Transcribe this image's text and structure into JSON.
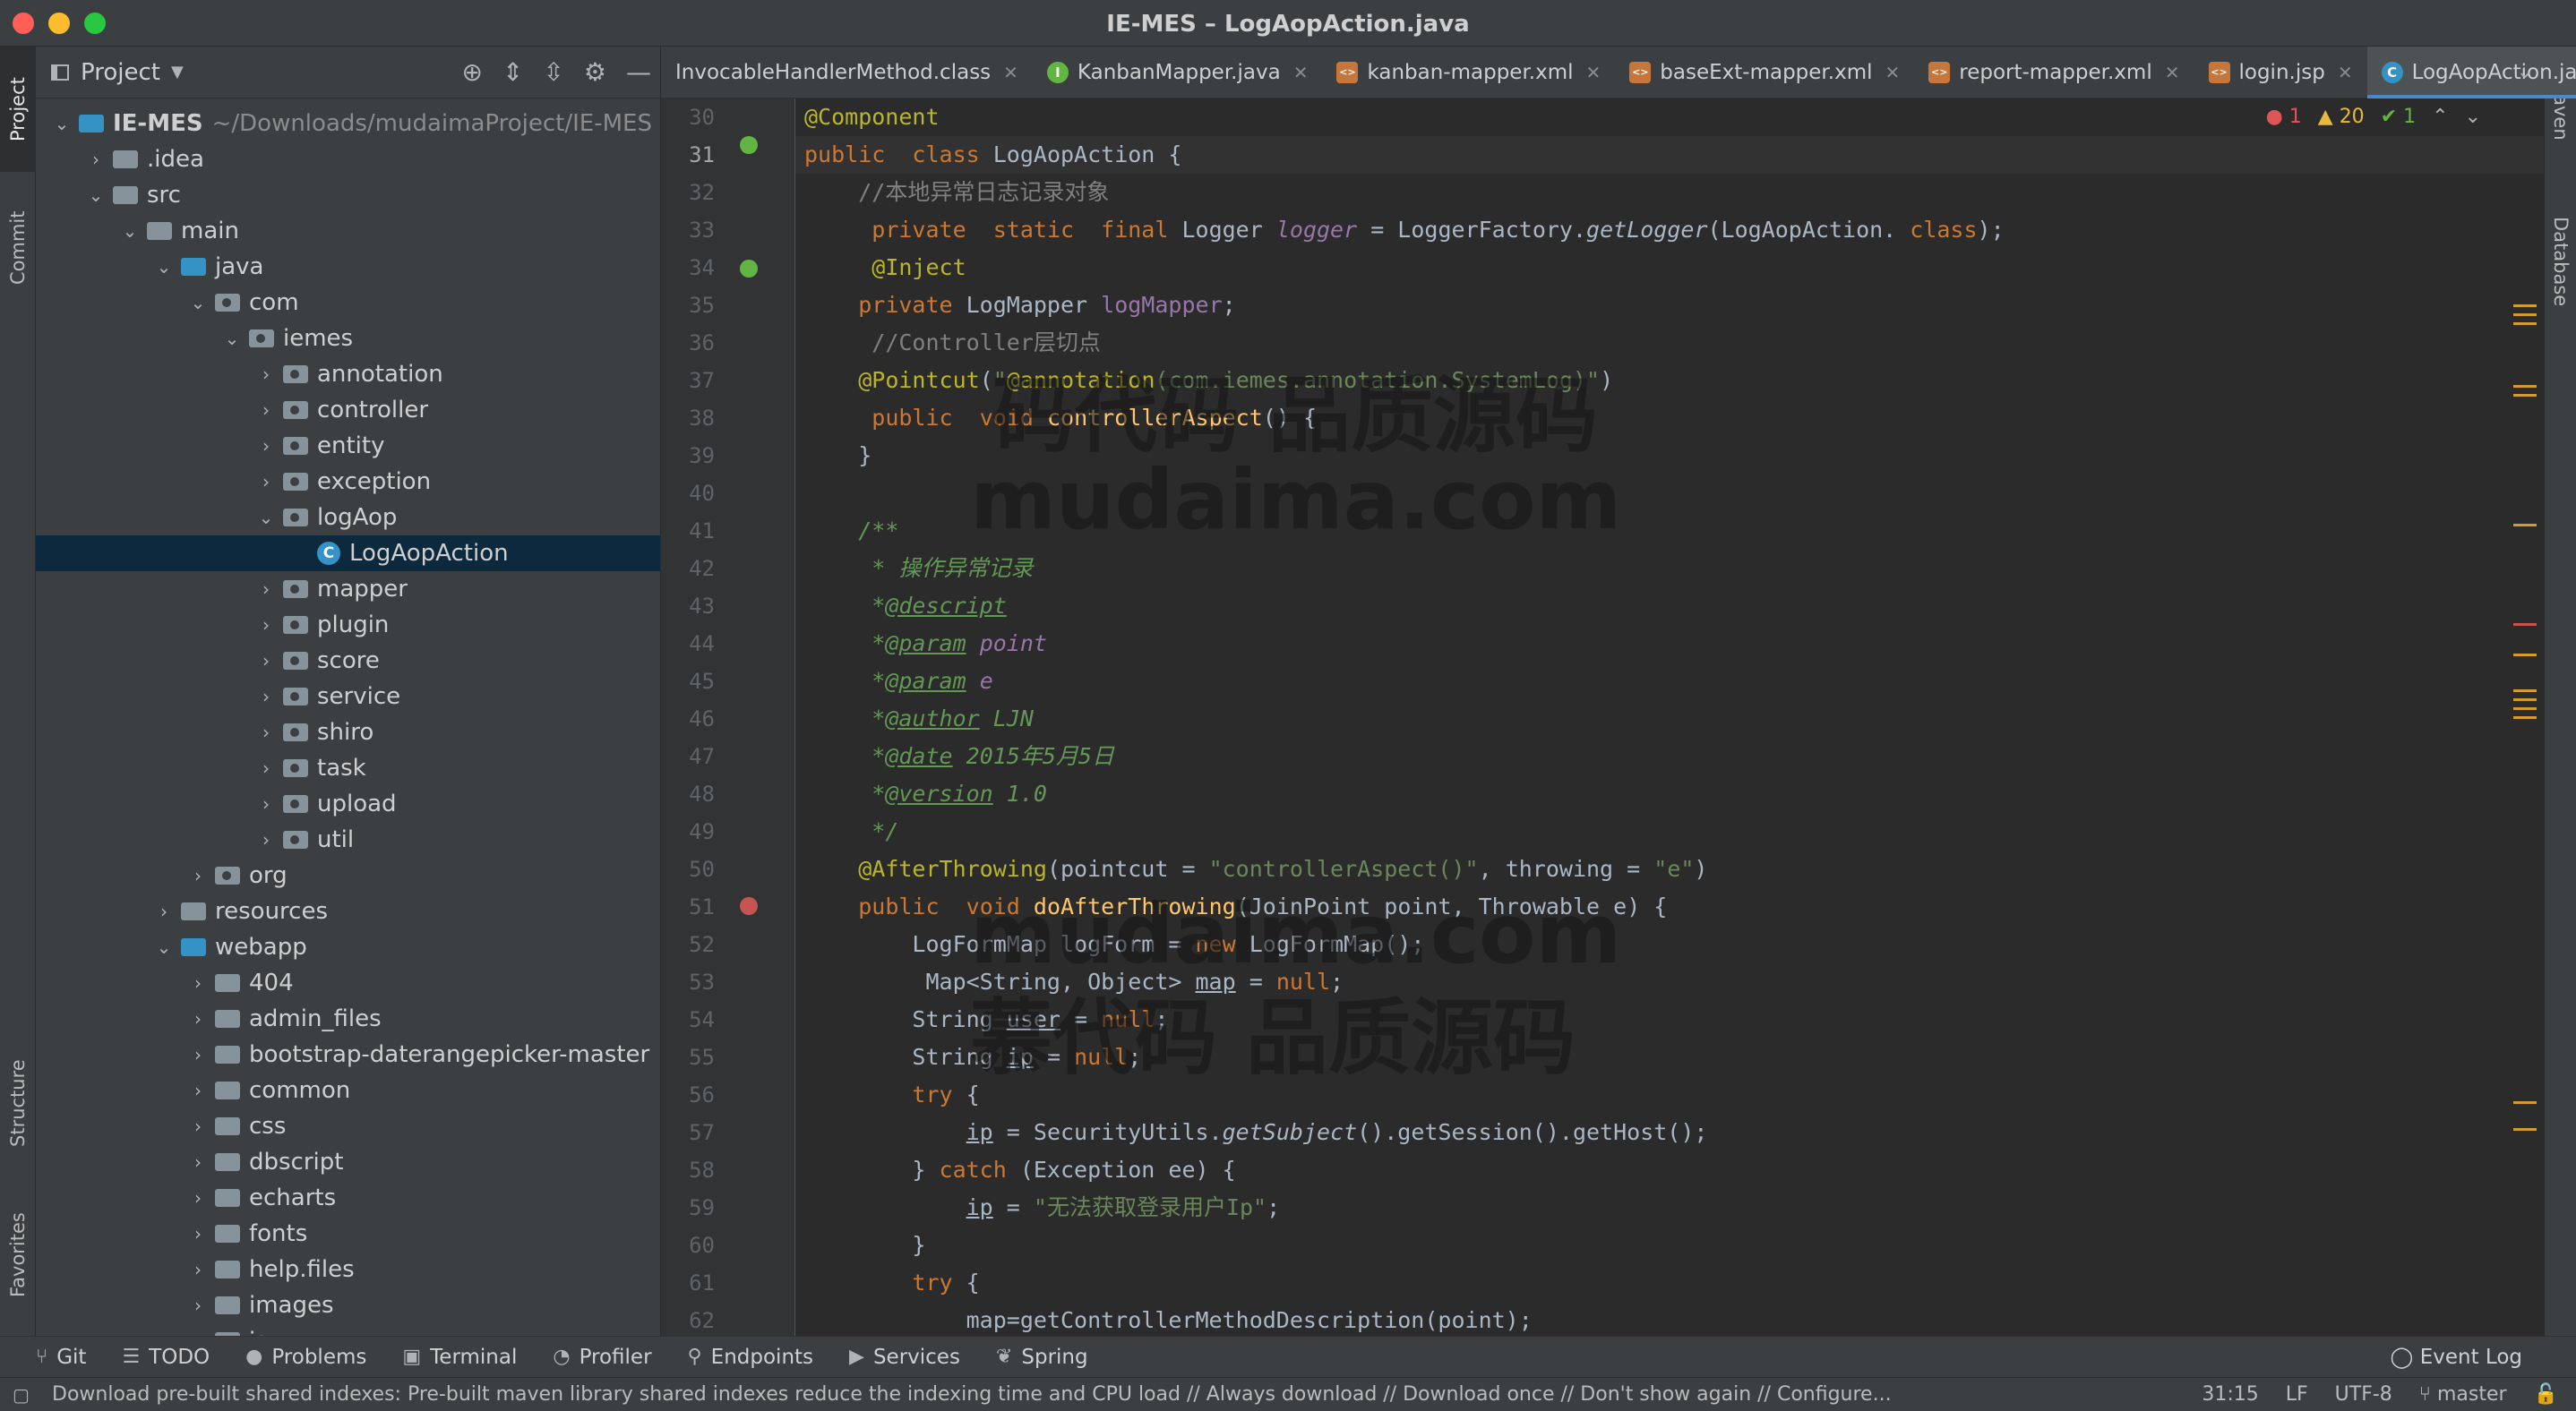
{
  "window": {
    "title": "IE-MES – LogAopAction.java"
  },
  "left_tool_tabs": [
    "Project",
    "Commit",
    "Structure",
    "Favorites"
  ],
  "right_tool_tabs": [
    "Maven",
    "Database"
  ],
  "project_panel": {
    "title": "Project",
    "tree": [
      {
        "label": "IE-MES",
        "sub": "~/Downloads/mudaimaProject/IE-MES",
        "depth": 0,
        "open": true,
        "kind": "module"
      },
      {
        "label": ".idea",
        "depth": 1,
        "open": false,
        "kind": "folder"
      },
      {
        "label": "src",
        "depth": 1,
        "open": true,
        "kind": "folder"
      },
      {
        "label": "main",
        "depth": 2,
        "open": true,
        "kind": "folder"
      },
      {
        "label": "java",
        "depth": 3,
        "open": true,
        "kind": "src"
      },
      {
        "label": "com",
        "depth": 4,
        "open": true,
        "kind": "pkg"
      },
      {
        "label": "iemes",
        "depth": 5,
        "open": true,
        "kind": "pkg"
      },
      {
        "label": "annotation",
        "depth": 6,
        "open": false,
        "kind": "pkg"
      },
      {
        "label": "controller",
        "depth": 6,
        "open": false,
        "kind": "pkg"
      },
      {
        "label": "entity",
        "depth": 6,
        "open": false,
        "kind": "pkg"
      },
      {
        "label": "exception",
        "depth": 6,
        "open": false,
        "kind": "pkg"
      },
      {
        "label": "logAop",
        "depth": 6,
        "open": true,
        "kind": "pkg"
      },
      {
        "label": "LogAopAction",
        "depth": 7,
        "open": null,
        "kind": "class",
        "selected": true
      },
      {
        "label": "mapper",
        "depth": 6,
        "open": false,
        "kind": "pkg"
      },
      {
        "label": "plugin",
        "depth": 6,
        "open": false,
        "kind": "pkg"
      },
      {
        "label": "score",
        "depth": 6,
        "open": false,
        "kind": "pkg"
      },
      {
        "label": "service",
        "depth": 6,
        "open": false,
        "kind": "pkg"
      },
      {
        "label": "shiro",
        "depth": 6,
        "open": false,
        "kind": "pkg"
      },
      {
        "label": "task",
        "depth": 6,
        "open": false,
        "kind": "pkg"
      },
      {
        "label": "upload",
        "depth": 6,
        "open": false,
        "kind": "pkg"
      },
      {
        "label": "util",
        "depth": 6,
        "open": false,
        "kind": "pkg"
      },
      {
        "label": "org",
        "depth": 4,
        "open": false,
        "kind": "pkg"
      },
      {
        "label": "resources",
        "depth": 3,
        "open": false,
        "kind": "folder"
      },
      {
        "label": "webapp",
        "depth": 3,
        "open": true,
        "kind": "src"
      },
      {
        "label": "404",
        "depth": 4,
        "open": false,
        "kind": "folder"
      },
      {
        "label": "admin_files",
        "depth": 4,
        "open": false,
        "kind": "folder"
      },
      {
        "label": "bootstrap-daterangepicker-master",
        "depth": 4,
        "open": false,
        "kind": "folder"
      },
      {
        "label": "common",
        "depth": 4,
        "open": false,
        "kind": "folder"
      },
      {
        "label": "css",
        "depth": 4,
        "open": false,
        "kind": "folder"
      },
      {
        "label": "dbscript",
        "depth": 4,
        "open": false,
        "kind": "folder"
      },
      {
        "label": "echarts",
        "depth": 4,
        "open": false,
        "kind": "folder"
      },
      {
        "label": "fonts",
        "depth": 4,
        "open": false,
        "kind": "folder"
      },
      {
        "label": "help.files",
        "depth": 4,
        "open": false,
        "kind": "folder"
      },
      {
        "label": "images",
        "depth": 4,
        "open": false,
        "kind": "folder"
      },
      {
        "label": "js",
        "depth": 4,
        "open": false,
        "kind": "folder"
      }
    ]
  },
  "tabs": [
    {
      "label": "InvocableHandlerMethod.class",
      "icon": "none",
      "active": false
    },
    {
      "label": "KanbanMapper.java",
      "icon": "i",
      "active": false
    },
    {
      "label": "kanban-mapper.xml",
      "icon": "x",
      "active": false
    },
    {
      "label": "baseExt-mapper.xml",
      "icon": "x",
      "active": false
    },
    {
      "label": "report-mapper.xml",
      "icon": "x",
      "active": false
    },
    {
      "label": "login.jsp",
      "icon": "x",
      "active": false
    },
    {
      "label": "LogAopAction.java",
      "icon": "c",
      "active": true
    }
  ],
  "inspections": {
    "errors": "1",
    "warnings": "20",
    "ok": "1"
  },
  "editor": {
    "current_line": 31,
    "lines": [
      {
        "n": 30,
        "html": "<span class=\"ann\">@Component</span>"
      },
      {
        "n": 31,
        "html": "<span class=\"kw\">public</span>  <span class=\"kw\">class</span> LogAopAction {"
      },
      {
        "n": 32,
        "html": "    <span class=\"cmt\">//本地异常日志记录对象</span>"
      },
      {
        "n": 33,
        "html": "     <span class=\"kw\">private</span>  <span class=\"kw\">static</span>  <span class=\"kw\">final</span> Logger <span class=\"fi\">logger</span> = LoggerFactory.<span class=\"it\">getLogger</span>(LogAopAction. <span class=\"kw\">class</span>);"
      },
      {
        "n": 34,
        "html": "     <span class=\"ann\">@Inject</span>"
      },
      {
        "n": 35,
        "html": "    <span class=\"kw\">private</span> LogMapper <span class=\"fld\">logMapper</span>;"
      },
      {
        "n": 36,
        "html": "     <span class=\"cmt\">//Controller层切点</span>"
      },
      {
        "n": 37,
        "html": "    <span class=\"ann\">@Pointcut</span>(<span class=\"str\">\"</span><span class=\"ann\">@annotation</span><span class=\"str\">(com.iemes.annotation.SystemLog)\"</span>)"
      },
      {
        "n": 38,
        "html": "     <span class=\"kw\">public</span>  <span class=\"kw\">void</span> <span class=\"mth\">controllerAspect</span>() {"
      },
      {
        "n": 39,
        "html": "    }"
      },
      {
        "n": 40,
        "html": ""
      },
      {
        "n": 41,
        "html": "    <span class=\"doc\">/**</span>"
      },
      {
        "n": 42,
        "html": "     <span class=\"doc\">* 操作异常记录</span>"
      },
      {
        "n": 43,
        "html": "     <span class=\"doc\">*<u>@descript</u></span>"
      },
      {
        "n": 44,
        "html": "     <span class=\"doc\">*<u>@param</u> </span><span class=\"fld it\">point</span>"
      },
      {
        "n": 45,
        "html": "     <span class=\"doc\">*<u>@param</u> </span><span class=\"fld it\">e</span>"
      },
      {
        "n": 46,
        "html": "     <span class=\"doc\">*<u>@author</u> LJN</span>"
      },
      {
        "n": 47,
        "html": "     <span class=\"doc\">*<u>@date</u> 2015年5月5日</span>"
      },
      {
        "n": 48,
        "html": "     <span class=\"doc\">*<u>@version</u> 1.0</span>"
      },
      {
        "n": 49,
        "html": "     <span class=\"doc\">*/</span>"
      },
      {
        "n": 50,
        "html": "    <span class=\"ann\">@AfterThrowing</span>(pointcut = <span class=\"str\">\"controllerAspect()\"</span>, throwing = <span class=\"str\">\"e\"</span>)"
      },
      {
        "n": 51,
        "html": "    <span class=\"kw\">public</span>  <span class=\"kw\">void</span> <span class=\"mth\">doAfterThrowing</span>(JoinPoint point, Throwable e) {"
      },
      {
        "n": 52,
        "html": "        LogFormMap logForm = <span class=\"kw\">new</span> LogFormMap();"
      },
      {
        "n": 53,
        "html": "         Map&lt;String, Object&gt; <u>map</u> = <span class=\"kw\">null</span>;"
      },
      {
        "n": 54,
        "html": "        String <u>user</u> = <span class=\"kw\">null</span>;"
      },
      {
        "n": 55,
        "html": "        String <u>ip</u> = <span class=\"kw\">null</span>;"
      },
      {
        "n": 56,
        "html": "        <span class=\"kw\">try</span> {"
      },
      {
        "n": 57,
        "html": "            <u>ip</u> = SecurityUtils.<span class=\"it\">getSubject</span>().getSession().getHost();"
      },
      {
        "n": 58,
        "html": "        } <span class=\"kw\">catch</span> (Exception ee) {"
      },
      {
        "n": 59,
        "html": "            <u>ip</u> = <span class=\"str\">\"无法获取登录用户Ip\"</span>;"
      },
      {
        "n": 60,
        "html": "        }"
      },
      {
        "n": 61,
        "html": "        <span class=\"kw\">try</span> {"
      },
      {
        "n": 62,
        "html": "            map=getControllerMethodDescription(point);"
      }
    ]
  },
  "watermarks": [
    "码代码 品质源码",
    "mudaima.com",
    "mudaima.com",
    "慕代码 品质源码"
  ],
  "bottom_tools": [
    {
      "label": "Git",
      "icon": "⑂"
    },
    {
      "label": "TODO",
      "icon": "☰"
    },
    {
      "label": "Problems",
      "icon": "●"
    },
    {
      "label": "Terminal",
      "icon": "▣"
    },
    {
      "label": "Profiler",
      "icon": "◔"
    },
    {
      "label": "Endpoints",
      "icon": "⚲"
    },
    {
      "label": "Services",
      "icon": "▶"
    },
    {
      "label": "Spring",
      "icon": "❦"
    }
  ],
  "event_log": "Event Log",
  "status": {
    "message": "Download pre-built shared indexes: Pre-built maven library shared indexes reduce the indexing time and CPU load // Always download // Download once // Don't show again // Configure...",
    "position": "31:15",
    "line_sep": "LF",
    "encoding": "UTF-8",
    "branch": "master"
  }
}
